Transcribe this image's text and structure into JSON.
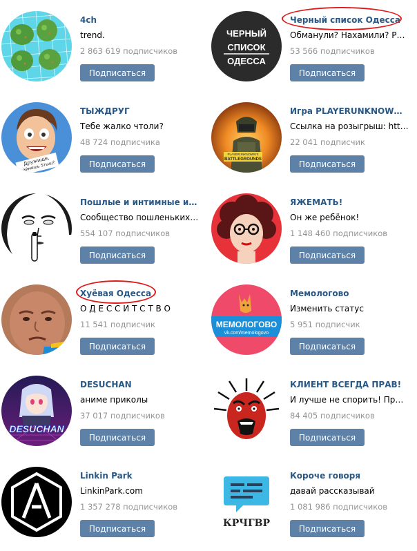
{
  "subscribe_label": "Подписаться",
  "groups": [
    {
      "title": "4ch",
      "status": "trend.",
      "subscribers": "2 863 619 подписчиков"
    },
    {
      "title": "Черный список Одесса",
      "status": "Обманули? Нахамили? Расскажи!",
      "subscribers": "53 566 подписчиков",
      "avatar_text": [
        "ЧЕРНЫЙ",
        "СПИСОК",
        "ОДЕССА"
      ]
    },
    {
      "title": "ТЫЖДРУГ",
      "status": "Тебе жалко чтоли?",
      "subscribers": "48 724 подписчика",
      "avatar_text": [
        "Дружище,",
        "займешь 5тыщ?"
      ]
    },
    {
      "title": "Игра PLAYERUNKNOWN'S BATTLEGROUNDS",
      "status": "Ссылка на розыгрыш: https://vk.cc/",
      "subscribers": "22 041 подписчик",
      "avatar_text": [
        "PLAYERUNKNOWN'S",
        "BATTLEGROUNDS"
      ]
    },
    {
      "title": "Пошлые и интимные истории",
      "status": "Сообщество пошленьких любителей",
      "subscribers": "554 107 подписчиков"
    },
    {
      "title": "ЯЖЕМАТЬ!",
      "status": "Он же ребёнок!",
      "subscribers": "1 148 460 подписчиков"
    },
    {
      "title": "Хуёвая Одесса",
      "status": "О Д Е С С И Т С Т В О",
      "subscribers": "11 541 подписчик"
    },
    {
      "title": "Мемологово",
      "status": "Изменить статус",
      "subscribers": "5 951 подписчик",
      "avatar_text": [
        "МЕМОЛОГОВО",
        "vk.com/memologovo"
      ]
    },
    {
      "title": "DESUCHAN",
      "status": "аниме приколы",
      "subscribers": "37 017 подписчиков",
      "avatar_text": [
        "DESUCHAN"
      ]
    },
    {
      "title": "КЛИЕНТ ВСЕГДА ПРАВ!",
      "status": "И лучше не спорить! Присылайте",
      "subscribers": "84 405 подписчиков"
    },
    {
      "title": "Linkin Park",
      "status": "LinkinPark.com",
      "subscribers": "1 357 278 подписчиков"
    },
    {
      "title": "Короче говоря",
      "status": "давай рассказывай",
      "subscribers": "1 081 986 подписчиков",
      "avatar_text": [
        "КРЧГВР"
      ]
    }
  ],
  "colors": {
    "link": "#2a5885",
    "button": "#5e81a8",
    "muted": "#939393",
    "annotation": "#e01b1b"
  }
}
